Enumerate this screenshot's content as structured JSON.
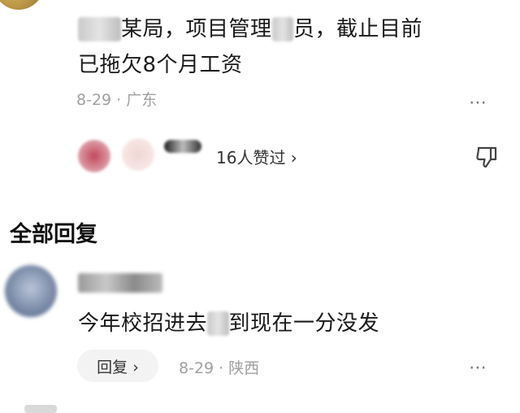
{
  "comment": {
    "author_hidden": true,
    "text_parts": {
      "prefix_masked": "某某",
      "line": "某局，项目管理",
      "mid_masked": "人",
      "line_end": "员，截止目前",
      "line2_prefix": "已",
      "line2": "拖欠8个月工资"
    },
    "date_location": "8-29 · 广东",
    "likes_text": "16人赞过 ›"
  },
  "replies_section": {
    "title": "全部回复"
  },
  "reply": {
    "text_a": "今年校招进去",
    "text_b": "到现在一分没发",
    "reply_button": "回复 ›",
    "date_location": "8-29 · 陕西"
  },
  "icons": {
    "more": "more-dots-icon",
    "dislike": "thumbs-down-icon"
  }
}
